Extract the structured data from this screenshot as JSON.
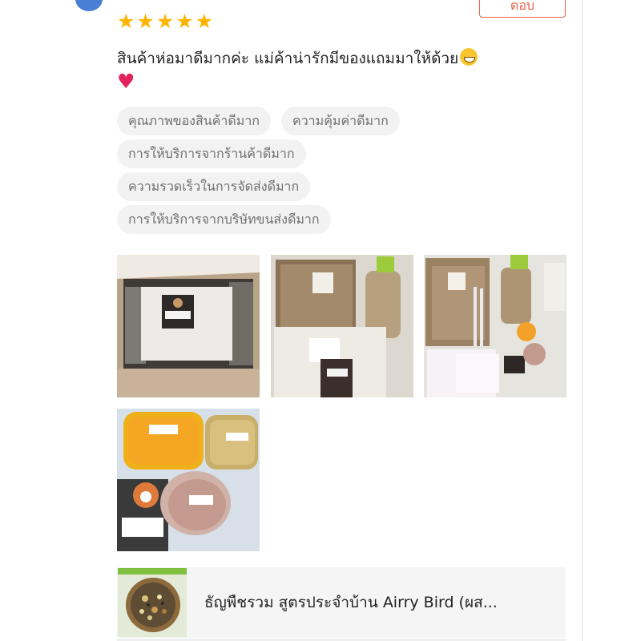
{
  "review": {
    "rating": 5,
    "reply_label": "ตอบ",
    "text": "สินค้าห่อมาดีมากค่ะ แม่ค้าน่ารักมีของแถมมาให้ด้วย",
    "emojis": [
      "grinning-face",
      "red-heart"
    ],
    "tags": [
      [
        "คุณภาพของสินค้าดีมาก",
        "ความคุ้มค่าดีมาก"
      ],
      [
        "การให้บริการจากร้านค้าดีมาก"
      ],
      [
        "ความรวดเร็วในการจัดส่งดีมาก"
      ],
      [
        "การให้บริการจากบริษัทขนส่งดีมาก"
      ]
    ],
    "photo_count": 4
  },
  "product": {
    "name": "ธัญพืชรวม สูตรประจำบ้าน Airry Bird (ผส..."
  },
  "colors": {
    "accent": "#e8624a",
    "star": "#ffb400",
    "tag_bg": "#f2f2f2",
    "tag_text": "#6e6e6e",
    "card_bg": "#f5f5f5"
  }
}
